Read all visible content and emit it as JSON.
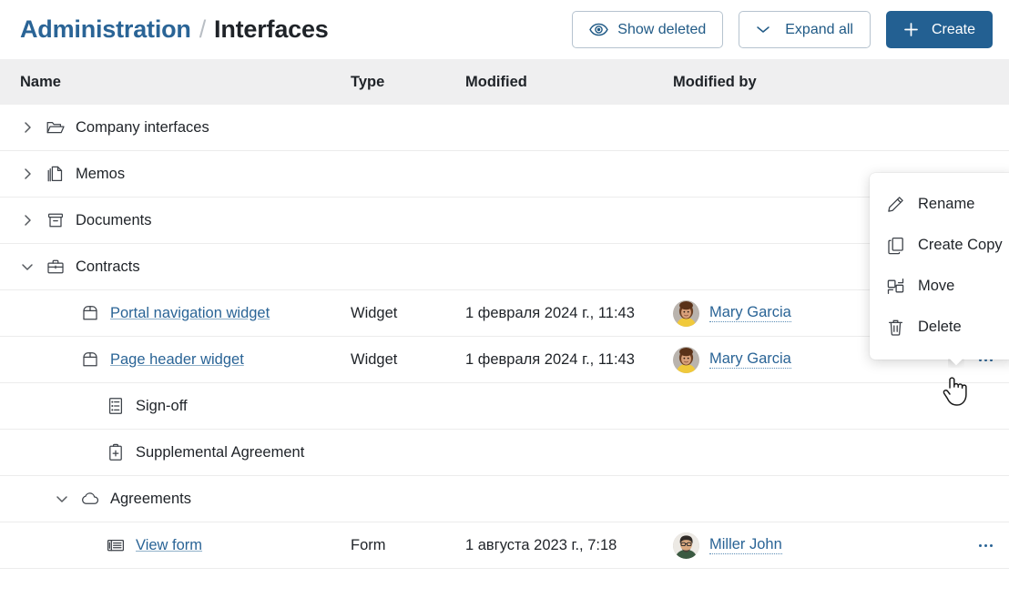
{
  "header": {
    "breadcrumb": {
      "parent": "Administration",
      "separator": "/",
      "current": "Interfaces"
    },
    "actions": {
      "show_deleted": "Show deleted",
      "expand_all": "Expand all",
      "create": "Create"
    }
  },
  "table": {
    "columns": {
      "name": "Name",
      "type": "Type",
      "modified": "Modified",
      "modified_by": "Modified by"
    },
    "rows": [
      {
        "label": "Company interfaces",
        "icon": "folder-open-icon",
        "indent": 1,
        "chevron": "right",
        "link": false,
        "type": "",
        "modified": "",
        "modified_by": "",
        "avatar": "",
        "actions": false
      },
      {
        "label": "Memos",
        "icon": "copy-pages-icon",
        "indent": 1,
        "chevron": "right",
        "link": false,
        "type": "",
        "modified": "",
        "modified_by": "",
        "avatar": "",
        "actions": false
      },
      {
        "label": "Documents",
        "icon": "archive-box-icon",
        "indent": 1,
        "chevron": "right",
        "link": false,
        "type": "",
        "modified": "",
        "modified_by": "",
        "avatar": "",
        "actions": false
      },
      {
        "label": "Contracts",
        "icon": "briefcase-icon",
        "indent": 1,
        "chevron": "down",
        "link": false,
        "type": "",
        "modified": "",
        "modified_by": "",
        "avatar": "",
        "actions": false
      },
      {
        "label": "Portal navigation widget",
        "icon": "widget-box-icon",
        "indent": 2,
        "chevron": "none",
        "link": true,
        "type": "Widget",
        "modified": "1 февраля 2024 г., 11:43",
        "modified_by": "Mary Garcia",
        "avatar": "female",
        "actions": false
      },
      {
        "label": "Page header widget",
        "icon": "widget-box-icon",
        "indent": 2,
        "chevron": "none",
        "link": true,
        "type": "Widget",
        "modified": "1 февраля 2024 г., 11:43",
        "modified_by": "Mary Garcia",
        "avatar": "female",
        "actions": true
      },
      {
        "label": "Sign-off",
        "icon": "checklist-icon",
        "indent": 3,
        "chevron": "none",
        "link": false,
        "type": "",
        "modified": "",
        "modified_by": "",
        "avatar": "",
        "actions": false
      },
      {
        "label": "Supplemental Agreement",
        "icon": "clipboard-plus-icon",
        "indent": 3,
        "chevron": "none",
        "link": false,
        "type": "",
        "modified": "",
        "modified_by": "",
        "avatar": "",
        "actions": false
      },
      {
        "label": "Agreements",
        "icon": "cloud-icon",
        "indent": 2,
        "chevron": "down",
        "link": false,
        "type": "",
        "modified": "",
        "modified_by": "",
        "avatar": "",
        "actions": false
      },
      {
        "label": "View form",
        "icon": "form-view-icon",
        "indent": 3,
        "chevron": "none",
        "link": true,
        "type": "Form",
        "modified": "1 августа 2023 г., 7:18",
        "modified_by": "Miller John",
        "avatar": "male",
        "actions": true
      }
    ]
  },
  "context_menu": {
    "items": [
      {
        "label": "Rename",
        "icon": "pencil-icon"
      },
      {
        "label": "Create Copy",
        "icon": "copy-icon"
      },
      {
        "label": "Move",
        "icon": "move-icon"
      },
      {
        "label": "Delete",
        "icon": "trash-icon"
      }
    ]
  },
  "colors": {
    "accent": "#2a6496",
    "primary_button": "#236092",
    "header_row_bg": "#efeff0",
    "row_border": "#ececec",
    "text": "#1f2328"
  }
}
